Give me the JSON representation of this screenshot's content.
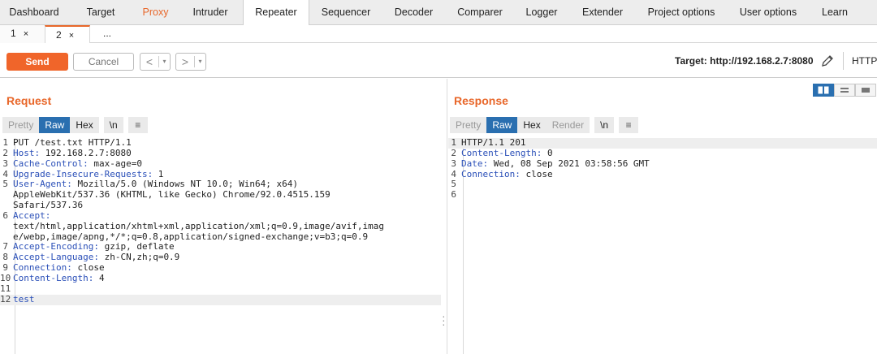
{
  "main_tabs": [
    {
      "label": "Dashboard"
    },
    {
      "label": "Target"
    },
    {
      "label": "Proxy"
    },
    {
      "label": "Intruder"
    },
    {
      "label": "Repeater"
    },
    {
      "label": "Sequencer"
    },
    {
      "label": "Decoder"
    },
    {
      "label": "Comparer"
    },
    {
      "label": "Logger"
    },
    {
      "label": "Extender"
    },
    {
      "label": "Project options"
    },
    {
      "label": "User options"
    },
    {
      "label": "Learn"
    }
  ],
  "sub_tabs": [
    {
      "label": "1",
      "close": "×"
    },
    {
      "label": "2",
      "close": "×"
    },
    {
      "label": "..."
    }
  ],
  "toolbar": {
    "send_label": "Send",
    "cancel_label": "Cancel",
    "back_arrow": "<",
    "forward_arrow": ">",
    "dropdown_glyph": "▾",
    "target_text": "Target: http://192.168.2.7:8080",
    "http_label": "HTTP/"
  },
  "request": {
    "title": "Request",
    "view_tabs": {
      "pretty": "Pretty",
      "raw": "Raw",
      "hex": "Hex",
      "newline": "\\n",
      "menu": "≡"
    },
    "lines": [
      {
        "n": "1",
        "key": "",
        "val": "PUT /test.txt HTTP/1.1"
      },
      {
        "n": "2",
        "key": "Host:",
        "val": " 192.168.2.7:8080"
      },
      {
        "n": "3",
        "key": "Cache-Control:",
        "val": " max-age=0"
      },
      {
        "n": "4",
        "key": "Upgrade-Insecure-Requests:",
        "val": " 1"
      },
      {
        "n": "5",
        "key": "User-Agent:",
        "val": " Mozilla/5.0 (Windows NT 10.0; Win64; x64)"
      },
      {
        "n": "",
        "key": "",
        "val": "AppleWebKit/537.36 (KHTML, like Gecko) Chrome/92.0.4515.159"
      },
      {
        "n": "",
        "key": "",
        "val": "Safari/537.36"
      },
      {
        "n": "6",
        "key": "Accept:",
        "val": ""
      },
      {
        "n": "",
        "key": "",
        "val": "text/html,application/xhtml+xml,application/xml;q=0.9,image/avif,imag"
      },
      {
        "n": "",
        "key": "",
        "val": "e/webp,image/apng,*/*;q=0.8,application/signed-exchange;v=b3;q=0.9"
      },
      {
        "n": "7",
        "key": "Accept-Encoding:",
        "val": " gzip, deflate"
      },
      {
        "n": "8",
        "key": "Accept-Language:",
        "val": " zh-CN,zh;q=0.9"
      },
      {
        "n": "9",
        "key": "Connection:",
        "val": " close"
      },
      {
        "n": "10",
        "key": "Content-Length:",
        "val": " 4"
      },
      {
        "n": "11",
        "key": "",
        "val": ""
      },
      {
        "n": "12",
        "key": "test",
        "val": ""
      }
    ]
  },
  "response": {
    "title": "Response",
    "view_tabs": {
      "pretty": "Pretty",
      "raw": "Raw",
      "hex": "Hex",
      "render": "Render",
      "newline": "\\n",
      "menu": "≡"
    },
    "lines": [
      {
        "n": "1",
        "key": "",
        "val": "HTTP/1.1 201"
      },
      {
        "n": "2",
        "key": "Content-Length:",
        "val": " 0"
      },
      {
        "n": "3",
        "key": "Date:",
        "val": " Wed, 08 Sep 2021 03:58:56 GMT"
      },
      {
        "n": "4",
        "key": "Connection:",
        "val": " close"
      },
      {
        "n": "5",
        "key": "",
        "val": ""
      },
      {
        "n": "6",
        "key": "",
        "val": ""
      }
    ]
  },
  "colors": {
    "accent": "#e8672a",
    "send": "#f0652a",
    "selected": "#2a6fb0",
    "header_key": "#2a4fb8"
  }
}
